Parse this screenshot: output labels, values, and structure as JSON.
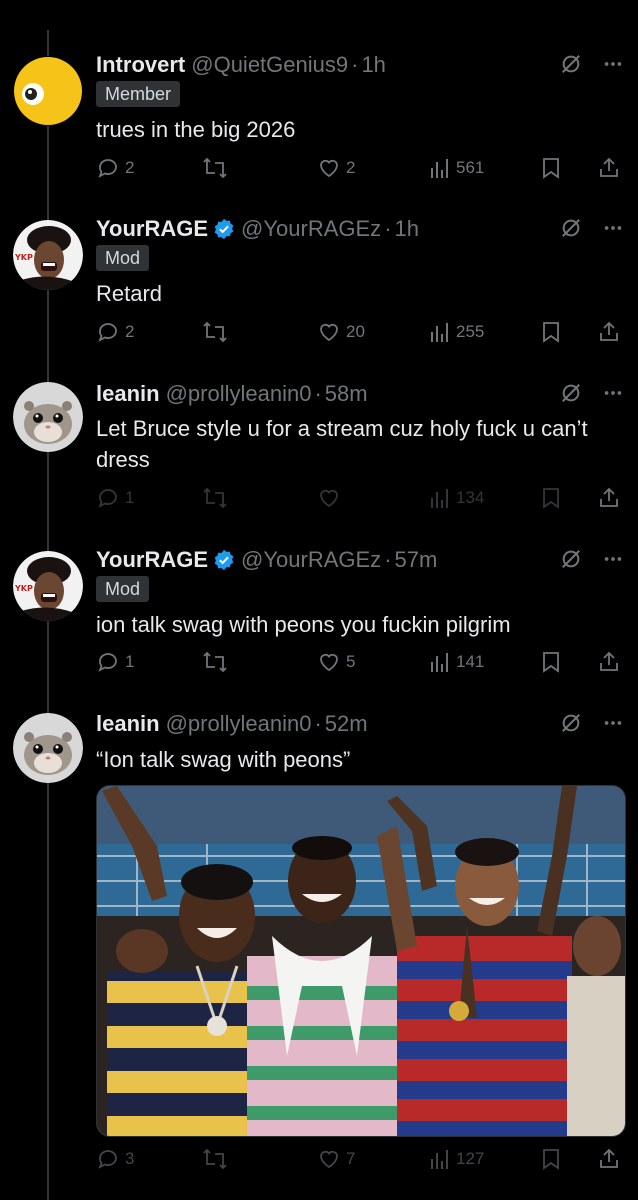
{
  "posts": [
    {
      "name": "Introvert",
      "handle": "@QuietGenius9",
      "time": "1h",
      "badge": "Member",
      "text": "trues in the big 2026",
      "replies": "2",
      "likes": "2",
      "views": "561",
      "avatar": "yellow-emoji-avatar"
    },
    {
      "name": "YourRAGE",
      "handle": "@YourRAGEz",
      "time": "1h",
      "badge": "Mod",
      "text": "Retard",
      "replies": "2",
      "likes": "20",
      "views": "255",
      "avatar": "cartoon-avatar"
    },
    {
      "name": "leanin",
      "handle": "@prollyleanin0",
      "time": "58m",
      "text": "Let Bruce style u for a stream cuz holy fuck u can’t dress",
      "replies": "1",
      "likes": "",
      "views": "134",
      "avatar": "hamster-avatar"
    },
    {
      "name": "YourRAGE",
      "handle": "@YourRAGEz",
      "time": "57m",
      "badge": "Mod",
      "text": "ion talk swag with peons you fuckin pilgrim",
      "replies": "1",
      "likes": "5",
      "views": "141",
      "avatar": "cartoon-avatar"
    },
    {
      "name": "leanin",
      "handle": "@prollyleanin0",
      "time": "52m",
      "text": "“Ion talk swag with peons”",
      "replies": "3",
      "likes": "7",
      "views": "127",
      "avatar": "hamster-avatar",
      "media": "group-photo"
    }
  ],
  "separator": "·",
  "colors": {
    "background": "#000000",
    "text": "#e7e9ea",
    "muted": "#71767b",
    "verified": "#1d9bf0"
  }
}
